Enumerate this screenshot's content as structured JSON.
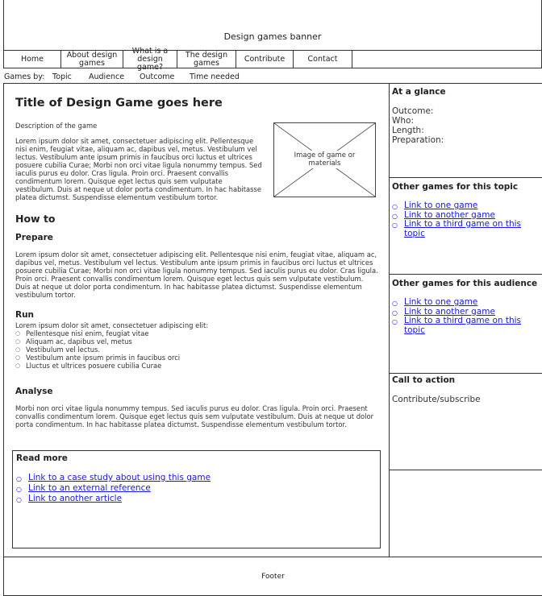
{
  "banner": {
    "text": "Design games banner"
  },
  "nav": {
    "items": [
      {
        "label": "Home"
      },
      {
        "label": "About design games"
      },
      {
        "label": "What is a design game?"
      },
      {
        "label": "The design games"
      },
      {
        "label": "Contribute"
      },
      {
        "label": "Contact"
      }
    ]
  },
  "games_by": {
    "label": "Games by:",
    "filters": [
      "Topic",
      "Audience",
      "Outcome",
      "Time needed"
    ]
  },
  "main": {
    "title": "Title of Design Game goes here",
    "description_label": "Description of the game",
    "intro": "Lorem ipsum dolor sit amet, consectetuer adipiscing elit. Pellentesque nisi enim, feugiat vitae, aliquam ac, dapibus vel, metus. Vestibulum vel lectus. Vestibulum ante ipsum primis in faucibus orci luctus et ultrices posuere cubilia Curae; Morbi non orci vitae ligula nonummy tempus. Sed iaculis purus eu dolor. Cras ligula. Proin orci. Praesent convallis condimentum lorem. Quisque eget lectus quis sem vulputate vestibulum. Duis at neque ut dolor porta condimentum. In hac habitasse platea dictumst. Suspendisse elementum vestibulum tortor.",
    "image_caption": "Image of game or materials",
    "how_to": "How to",
    "prepare": {
      "heading": "Prepare",
      "text": "Lorem ipsum dolor sit amet, consectetuer adipiscing elit. Pellentesque nisi enim, feugiat vitae, aliquam ac, dapibus vel, metus. Vestibulum vel lectus. Vestibulum ante ipsum primis in faucibus orci luctus et ultrices posuere cubilia Curae; Morbi non orci vitae ligula nonummy tempus. Sed iaculis purus eu dolor. Cras ligula. Proin orci. Praesent convallis condimentum lorem. Quisque eget lectus quis sem vulputate vestibulum. Duis at neque ut dolor porta condimentum. In hac habitasse platea dictumst. Suspendisse elementum vestibulum tortor."
    },
    "run": {
      "heading": "Run",
      "intro": "Lorem ipsum dolor sit amet, consectetuer adipiscing elit:",
      "items": [
        "Pellentesque nisi enim, feugiat vitae",
        "Aliquam ac, dapibus vel, metus",
        "Vestibulum vel lectus.",
        "Vestibulum ante ipsum primis in faucibus orci",
        "Lluctus et ultrices posuere cubilia Curae"
      ]
    },
    "analyse": {
      "heading": "Analyse",
      "text": "Morbi non orci vitae ligula nonummy tempus. Sed iaculis purus eu dolor. Cras ligula. Proin orci. Praesent convallis condimentum lorem. Quisque eget lectus quis sem vulputate vestibulum. Duis at neque ut dolor porta condimentum. In hac habitasse platea dictumst. Suspendisse elementum vestibulum tortor."
    },
    "read_more": {
      "heading": "Read more",
      "links": [
        "Link to a case study about using this game",
        "Link to an external reference",
        "Link to another article"
      ]
    }
  },
  "sidebar": {
    "at_a_glance": {
      "heading": "At a glance",
      "fields": [
        "Outcome:",
        "Who:",
        "Length:",
        "Preparation:"
      ]
    },
    "topic": {
      "heading": "Other games for this topic",
      "links": [
        "Link to one game",
        "Link to another game",
        "Link to a third game on this topic"
      ]
    },
    "audience": {
      "heading": "Other games for this audience",
      "links": [
        "Link to one game",
        "Link to another game",
        "Link to a third game on this topic"
      ]
    },
    "cta": {
      "heading": "Call to action",
      "text": "Contribute/subscribe"
    }
  },
  "footer": {
    "text": "Footer"
  },
  "colors": {
    "link": "#1a1adb",
    "border": "#333333"
  }
}
